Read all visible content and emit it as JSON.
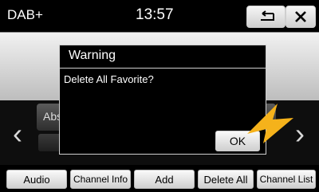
{
  "header": {
    "source_label": "DAB+",
    "time": "13:57",
    "back_icon": "back-arrow-icon",
    "close_icon": "close-icon"
  },
  "background": {
    "info_text": "",
    "preset_text": "Abs",
    "left_arrow": "‹",
    "right_arrow": "›"
  },
  "dialog": {
    "title": "Warning",
    "message": "Delete All Favorite?",
    "ok_label": "OK"
  },
  "bottom_bar": {
    "audio": "Audio",
    "channel_info": "Channel Info",
    "add": "Add",
    "delete_all": "Delete All",
    "channel_list": "Channel List"
  },
  "colors": {
    "accent_pointer": "#f5b21b"
  }
}
